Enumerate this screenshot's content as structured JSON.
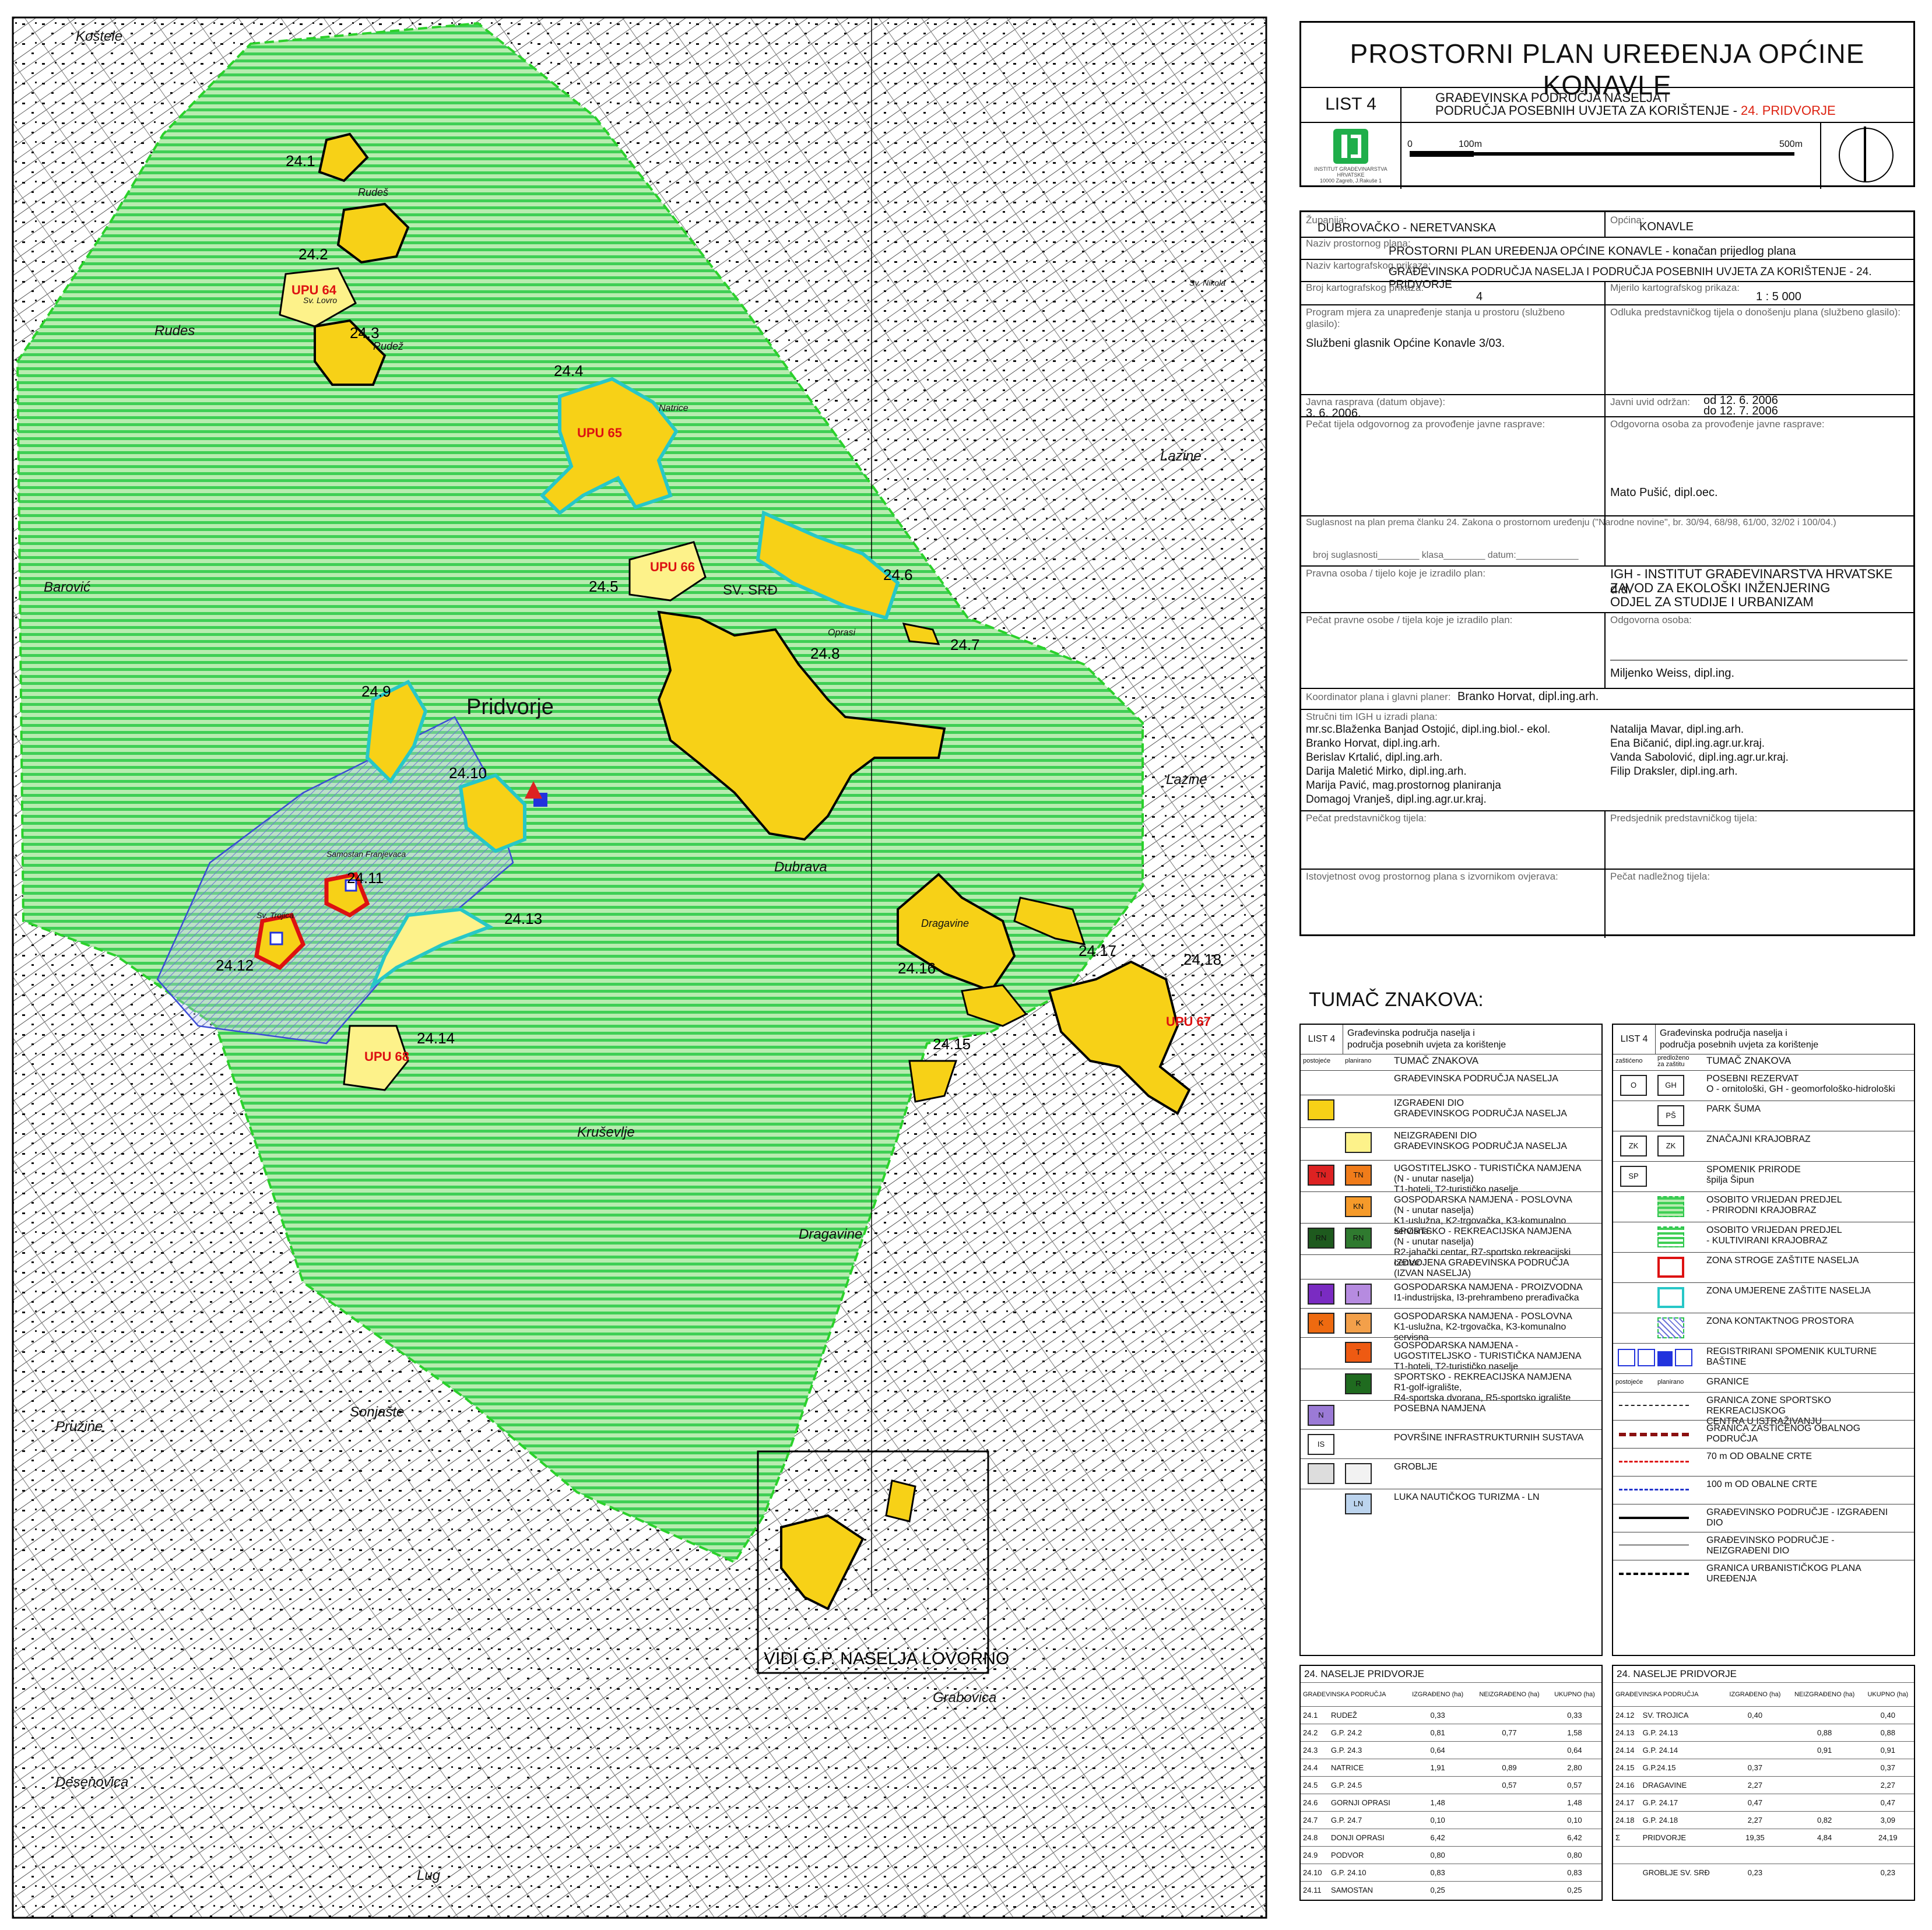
{
  "title": "PROSTORNI PLAN UREĐENJA OPĆINE KONAVLE",
  "list": "LIST 4",
  "subtitle_line1": "GRAĐEVINSKA PODRUČJA NASELJA I",
  "subtitle_line2": "PODRUČJA POSEBNIH UVJETA ZA KORIŠTENJE - ",
  "subtitle_red": "24. PRIDVORJE",
  "scale_bar": {
    "zero": "0",
    "mid": "100m",
    "end": "500m"
  },
  "institute_small": [
    "INSTITUT GRAĐEVINARSTVA",
    "HRVATSKE",
    "10000 Zagreb, J.Rakuše 1"
  ],
  "colors": {
    "built": "#f7d117",
    "unbuilt": "#fdf28a",
    "green": "#27c24a",
    "cyan": "#27c7c7",
    "red": "#dd1111",
    "blue_zone": "#3b4bd6"
  },
  "meta": {
    "zupanija_lbl": "Županija:",
    "zupanija": "DUBROVAČKO - NERETVANSKA",
    "opcina_lbl": "Općina:",
    "opcina": "KONAVLE",
    "naziv_plana_lbl": "Naziv prostornog plana:",
    "naziv_plana": "PROSTORNI PLAN UREĐENJA OPĆINE KONAVLE - konačan prijedlog plana",
    "naziv_prikaza_lbl": "Naziv kartografskog prikaza:",
    "naziv_prikaza": "GRAĐEVINSKA PODRUČJA NASELJA I PODRUČJA POSEBNIH UVJETA ZA KORIŠTENJE - 24. PRIDVORJE",
    "broj_lbl": "Broj kartografskog prikaza:",
    "broj": "4",
    "mjerilo_lbl": "Mjerilo kartografskog prikaza:",
    "mjerilo": "1 : 5 000",
    "program_lbl": "Program mjera za unapređenje stanja u prostoru (službeno glasilo):",
    "program": "Službeni glasnik Općine Konavle 3/03.",
    "odluka_lbl": "Odluka predstavničkog tijela o donošenju plana (službeno glasilo):",
    "javna_lbl": "Javna rasprava (datum objave):",
    "javna": "3. 6. 2006.",
    "uvid_lbl": "Javni uvid održan:",
    "uvid1": "od 12. 6. 2006",
    "uvid2": "do 12. 7. 2006",
    "pecat_lbl": "Pečat tijela odgovornog za provođenje javne rasprave:",
    "odgovorna_lbl": "Odgovorna osoba za provođenje javne rasprave:",
    "odgovorna": "Mato Pušić, dipl.oec.",
    "suglasnost": "Suglasnost na plan prema članku   24.  Zakona o prostornom uređenju   (\"Narodne novine\", br. 30/94, 68/98, 61/00, 32/02 i 100/04.)",
    "broj_sug": "broj suglasnosti________  klasa________  datum:____________",
    "pravna_lbl": "Pravna osoba / tijelo koje je izradilo plan:",
    "pravna1": "IGH - INSTITUT GRAĐEVINARSTVA HRVATSKE d.d.",
    "pravna2": "ZAVOD ZA EKOLOŠKI INŽENJERING",
    "pravna3": "ODJEL ZA STUDIJE I URBANIZAM",
    "pecat_pravne_lbl": "Pečat pravne osobe / tijela koje je izradilo plan:",
    "odg_osoba_lbl": "Odgovorna osoba:",
    "odg_osoba": "Miljenko Weiss, dipl.ing.",
    "koordinator_lbl": "Koordinator plana i glavni planer:",
    "koordinator": "Branko Horvat, dipl.ing.arh.",
    "strucni_lbl": "Stručni tim IGH u izradi plana:",
    "tim_left": [
      "mr.sc.Blaženka Banjad Ostojić, dipl.ing.biol.- ekol.",
      "Branko Horvat, dipl.ing.arh.",
      "Berislav Krtalić, dipl.ing.arh.",
      "Darija Maletić Mirko, dipl.ing.arh.",
      "Marija Pavić, mag.prostornog planiranja",
      "Domagoj Vranješ, dipl.ing.agr.ur.kraj."
    ],
    "tim_right": [
      "Natalija Mavar, dipl.ing.arh.",
      "Ena Bičanić, dipl.ing.agr.ur.kraj.",
      "Vanda Sabolović, dipl.ing.agr.ur.kraj.",
      "Filip Draksler, dipl.ing.arh."
    ],
    "pecat_pred_lbl": "Pečat predstavničkog tijela:",
    "predsjednik_lbl": "Predsjednik predstavničkog tijela:",
    "istovjetnost_lbl": "Istovjetnost ovog prostornog plana s izvornikom ovjerava:",
    "pecat_nadl_lbl": "Pečat nadležnog tijela:"
  },
  "legend": {
    "title": "TUMAČ ZNAKOVA:",
    "left_head": {
      "list": "LIST 4",
      "t1": "Građevinska područja naselja i",
      "t2": "područja posebnih uvjeta za korištenje",
      "col1": "postojeće",
      "col2": "planirano",
      "col3": "TUMAČ ZNAKOVA"
    },
    "right_head": {
      "list": "LIST 4",
      "t1": "Građevinska područja naselja i",
      "t2": "područja posebnih uvjeta za korištenje",
      "col1": "zaštićeno",
      "col2": "predloženo za zaštitu",
      "col3": "TUMAČ ZNAKOVA"
    },
    "left": [
      {
        "text": "GRAĐEVINSKA PODRUČJA NASELJA",
        "a": "",
        "b": "",
        "sa": "",
        "sb": ""
      },
      {
        "text": "IZGRAĐENI DIO|GRAĐEVINSKOG PODRUČJA NASELJA",
        "a": "",
        "b": "",
        "sa": "#f7d117",
        "sb": ""
      },
      {
        "text": "NEIZGRAĐENI DIO|GRAĐEVINSKOG PODRUČJA NASELJA",
        "a": "",
        "b": "",
        "sa": "",
        "sb": "#fdf28a"
      },
      {
        "text": "UGOSTITELJSKO - TURISTIČKA NAMJENA|(N - unutar naselja)|T1-hoteli, T2-turističko naselje",
        "a": "TN",
        "b": "TN",
        "sa": "#dd2222",
        "sb": "#f07c1a"
      },
      {
        "text": "GOSPODARSKA NAMJENA - POSLOVNA|(N - unutar naselja)|K1-uslužna, K2-trgovačka, K3-komunalno servisna",
        "a": "",
        "b": "KN",
        "sa": "",
        "sb": "#f59a2a"
      },
      {
        "text": "SPORTSKO - REKREACIJSKA NAMJENA|(N - unutar naselja)|R2-jahački centar, R7-sportsko rekreacijski centar",
        "a": "RN",
        "b": "RN",
        "sa": "#1e5a1e",
        "sb": "#2f7a2f"
      },
      {
        "text": "IZDVOJENA GRAĐEVINSKA PODRUČJA|(IZVAN NASELJA)",
        "a": "",
        "b": "",
        "sa": "",
        "sb": ""
      },
      {
        "text": "GOSPODARSKA NAMJENA - PROIZVODNA|I1-industrijska, I3-prehrambeno prerađivačka",
        "a": "I",
        "b": "I",
        "sa": "#7a2bc2",
        "sb": "#b68be0"
      },
      {
        "text": "GOSPODARSKA NAMJENA - POSLOVNA|K1-uslužna, K2-trgovačka, K3-komunalno servisna",
        "a": "K",
        "b": "K",
        "sa": "#ee6a10",
        "sb": "#f3a04a"
      },
      {
        "text": "GOSPODARSKA NAMJENA -|UGOSTITELJSKO - TURISTIČKA NAMJENA|T1-hoteli, T2-turističko naselje",
        "a": "",
        "b": "T",
        "sa": "",
        "sb": "#ee5a12"
      },
      {
        "text": "SPORTSKO - REKREACIJSKA NAMJENA|R1-golf-igralište,|R4-sportska dvorana, R5-sportsko igralište",
        "a": "",
        "b": "R",
        "sa": "",
        "sb": "#1f6b1f"
      },
      {
        "text": "POSEBNA NAMJENA",
        "a": "N",
        "b": "",
        "sa": "#9b7ad6",
        "sb": ""
      },
      {
        "text": "POVRŠINE INFRASTRUKTURNIH SUSTAVA",
        "a": "IS",
        "b": "",
        "sa": "#ffffff",
        "sb": ""
      },
      {
        "text": "GROBLJE",
        "a": "",
        "b": "",
        "sa": "#dddddd",
        "sb": "#f2f2f2"
      },
      {
        "text": "LUKA NAUTIČKOG TURIZMA - LN",
        "a": "",
        "b": "LN",
        "sa": "",
        "sb": "#bcd4ee"
      }
    ],
    "right": [
      {
        "text": "POSEBNI REZERVAT|O - ornitološki, GH - geomorfološko-hidrološki",
        "a": "O",
        "b": "GH"
      },
      {
        "text": "PARK ŠUMA",
        "a": "",
        "b": "PŠ"
      },
      {
        "text": "ZNAČAJNI KRAJOBRAZ",
        "a": "ZK",
        "b": "ZK"
      },
      {
        "text": "SPOMENIK PRIRODE|špilja Šipun",
        "a": "SP",
        "b": ""
      },
      {
        "text": "OSOBITO VRIJEDAN PREDJEL|- PRIRODNI KRAJOBRAZ",
        "a": "",
        "b": "~"
      },
      {
        "text": "OSOBITO VRIJEDAN PREDJEL|- KULTIVIRANI KRAJOBRAZ",
        "a": "",
        "b": "="
      },
      {
        "text": "ZONA STROGE ZAŠTITE NASELJA",
        "a": "",
        "b": "red"
      },
      {
        "text": "ZONA UMJERENE ZAŠTITE NASELJA",
        "a": "",
        "b": "cyan"
      },
      {
        "text": "ZONA KONTAKTNOG PROSTORA",
        "a": "",
        "b": "hatch"
      },
      {
        "text": "REGISTRIRANI SPOMENIK KULTURNE BAŠTINE",
        "a": "",
        "b": "monuments"
      },
      {
        "text": "GRANICE",
        "a": "postojeće",
        "b": "planirano"
      },
      {
        "text": "GRANICA ZONE SPORTSKO REKREACIJSKOG|CENTRA U ISTRAŽIVANJU",
        "a": "",
        "b": "dashdot"
      },
      {
        "text": "GRANICA ZAŠTIĆENOG OBALNOG PODRUČJA",
        "a": "",
        "b": "darkred"
      },
      {
        "text": "70 m OD OBALNE CRTE",
        "a": "",
        "b": "reddash"
      },
      {
        "text": "100 m OD OBALNE CRTE",
        "a": "",
        "b": "bluedash"
      },
      {
        "text": "GRAĐEVINSKO PODRUČJE - IZGRAĐENI DIO",
        "a": "",
        "b": "thick"
      },
      {
        "text": "GRAĐEVINSKO PODRUČJE - NEIZGRAĐENI DIO",
        "a": "",
        "b": "thin"
      },
      {
        "text": "GRANICA URBANISTIČKOG PLANA UREĐENJA",
        "a": "",
        "b": "dashdot2"
      }
    ]
  },
  "stats_left": {
    "title": "24. NASELJE PRIDVORJE",
    "cols": [
      "GRAĐEVINSKA PODRUČJA",
      "IZGRAĐENO (ha)",
      "NEIZGRAĐENO (ha)",
      "UKUPNO (ha)"
    ],
    "rows": [
      [
        "24.1",
        "RUDEŽ",
        "0,33",
        "",
        "0,33"
      ],
      [
        "24.2",
        "G.P. 24.2",
        "0,81",
        "0,77",
        "1,58"
      ],
      [
        "24.3",
        "G.P. 24.3",
        "0,64",
        "",
        "0,64"
      ],
      [
        "24.4",
        "NATRICE",
        "1,91",
        "0,89",
        "2,80"
      ],
      [
        "24.5",
        "G.P. 24.5",
        "",
        "0,57",
        "0,57"
      ],
      [
        "24.6",
        "GORNJI OPRASI",
        "1,48",
        "",
        "1,48"
      ],
      [
        "24.7",
        "G.P. 24.7",
        "0,10",
        "",
        "0,10"
      ],
      [
        "24.8",
        "DONJI OPRASI",
        "6,42",
        "",
        "6,42"
      ],
      [
        "24.9",
        "PODVOR",
        "0,80",
        "",
        "0,80"
      ],
      [
        "24.10",
        "G.P. 24.10",
        "0,83",
        "",
        "0,83"
      ],
      [
        "24.11",
        "SAMOSTAN",
        "0,25",
        "",
        "0,25"
      ]
    ]
  },
  "stats_right": {
    "title": "24. NASELJE PRIDVORJE",
    "cols": [
      "GRAĐEVINSKA PODRUČJA",
      "IZGRAĐENO (ha)",
      "NEIZGRAĐENO (ha)",
      "UKUPNO (ha)"
    ],
    "rows": [
      [
        "24.12",
        "SV. TROJICA",
        "0,40",
        "",
        "0,40"
      ],
      [
        "24.13",
        "G.P. 24.13",
        "",
        "0,88",
        "0,88"
      ],
      [
        "24.14",
        "G.P. 24.14",
        "",
        "0,91",
        "0,91"
      ],
      [
        "24.15",
        "G.P.24.15",
        "0,37",
        "",
        "0,37"
      ],
      [
        "24.16",
        "DRAGAVINE",
        "2,27",
        "",
        "2,27"
      ],
      [
        "24.17",
        "G.P. 24.17",
        "0,47",
        "",
        "0,47"
      ],
      [
        "24.18",
        "G.P. 24.18",
        "2,27",
        "0,82",
        "3,09"
      ],
      [
        "Σ",
        "PRIDVORJE",
        "19,35",
        "4,84",
        "24,19"
      ],
      [
        "",
        "",
        "",
        "",
        ""
      ],
      [
        "",
        "GROBLJE SV. SRĐ",
        "0,23",
        "",
        "0,23"
      ]
    ]
  },
  "map_labels": {
    "kostele": "Koštele",
    "rudes": "Rudes",
    "rudes2": "Rudeš",
    "rudez": "Rudež",
    "barovic": "Barović",
    "pridvorje": "Pridvorje",
    "lazine": "Lazine",
    "lazine2": "Lazine",
    "dubrava": "Dubrava",
    "krusevlje": "Kruševlje",
    "dragavine": "Dragavine",
    "dragavine2": "Dragavine",
    "pruzine": "Pružine",
    "sokolane": "Sonjašte",
    "grabovica": "Grabovica",
    "desenovica": "Desenovica",
    "lug": "Lug",
    "sv_srd": "SV. SRĐ",
    "vidi": "VIDI G.P. NASELJA LOVORNO",
    "natrice": "Natrice",
    "oprasi": "Oprasi",
    "sv_lovro": "Sv. Lovro",
    "sv_nikola": "Sv. Nikola",
    "samostan": "Samostan Franjevaca",
    "sv_trojica": "Sv. Trojica"
  },
  "zone_labels": [
    "24.1",
    "24.2",
    "24.3",
    "24.4",
    "24.5",
    "24.6",
    "24.7",
    "24.8",
    "24.9",
    "24.10",
    "24.11",
    "24.12",
    "24.13",
    "24.14",
    "24.15",
    "24.16",
    "24.17",
    "24.18"
  ],
  "upu_labels": [
    "UPU 64",
    "UPU 65",
    "UPU 66",
    "UPU 67",
    "UPU 68"
  ]
}
